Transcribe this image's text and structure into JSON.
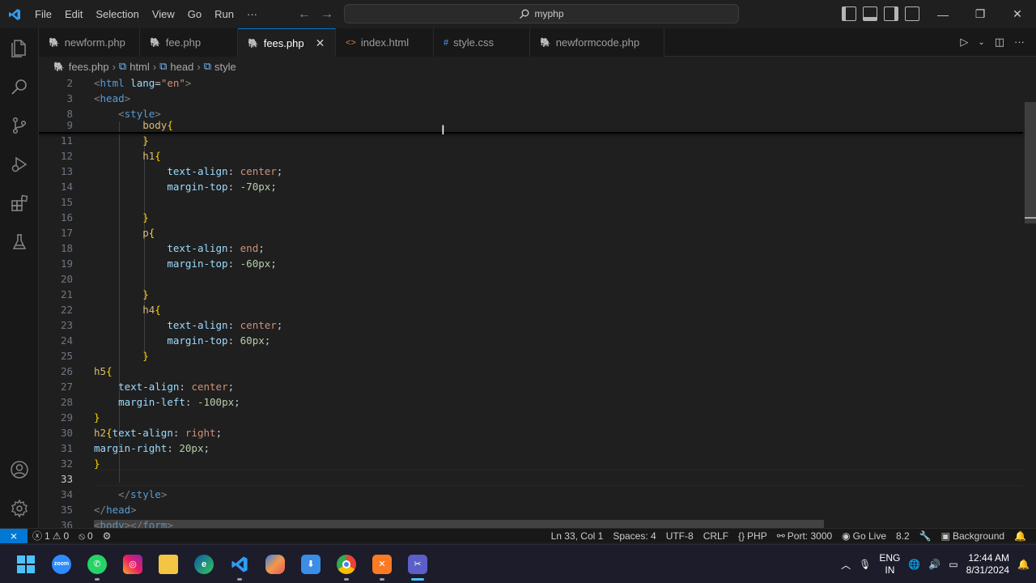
{
  "titlebar": {
    "menu": [
      "File",
      "Edit",
      "Selection",
      "View",
      "Go",
      "Run",
      "···"
    ],
    "search": "myphp"
  },
  "tabs": [
    {
      "label": "newform.php",
      "type": "php",
      "active": false
    },
    {
      "label": "fee.php",
      "type": "php",
      "active": false
    },
    {
      "label": "fees.php",
      "type": "php",
      "active": true
    },
    {
      "label": "index.html",
      "type": "html",
      "active": false
    },
    {
      "label": "style.css",
      "type": "css",
      "active": false
    },
    {
      "label": "newformcode.php",
      "type": "php",
      "active": false
    }
  ],
  "breadcrumb": [
    "fees.php",
    "html",
    "head",
    "style"
  ],
  "editor": {
    "current_line": "33",
    "lines": [
      {
        "n": "2",
        "text": "<html lang=\"en\">"
      },
      {
        "n": "3",
        "text": "<head>"
      },
      {
        "n": "8",
        "text": "    <style>"
      },
      {
        "n": "9",
        "text": "        body{"
      },
      {
        "n": "11",
        "text": "        }"
      },
      {
        "n": "12",
        "text": "        h1{"
      },
      {
        "n": "13",
        "text": "            text-align: center;"
      },
      {
        "n": "14",
        "text": "            margin-top: -70px;"
      },
      {
        "n": "15",
        "text": ""
      },
      {
        "n": "16",
        "text": "        }"
      },
      {
        "n": "17",
        "text": "        p{"
      },
      {
        "n": "18",
        "text": "            text-align: end;"
      },
      {
        "n": "19",
        "text": "            margin-top: -60px;"
      },
      {
        "n": "20",
        "text": ""
      },
      {
        "n": "21",
        "text": "        }"
      },
      {
        "n": "22",
        "text": "        h4{"
      },
      {
        "n": "23",
        "text": "            text-align: center;"
      },
      {
        "n": "24",
        "text": "            margin-top: 60px;"
      },
      {
        "n": "25",
        "text": "        }"
      },
      {
        "n": "26",
        "text": "h5{"
      },
      {
        "n": "27",
        "text": "    text-align: center;"
      },
      {
        "n": "28",
        "text": "    margin-left: -100px;"
      },
      {
        "n": "29",
        "text": "}"
      },
      {
        "n": "30",
        "text": "h2{text-align: right;"
      },
      {
        "n": "31",
        "text": "margin-right: 20px;"
      },
      {
        "n": "32",
        "text": "}"
      },
      {
        "n": "33",
        "text": ""
      },
      {
        "n": "34",
        "text": "    </style>"
      },
      {
        "n": "35",
        "text": "</head>"
      },
      {
        "n": "36",
        "text": "<body></form>"
      }
    ]
  },
  "statusbar": {
    "errors": "1",
    "warnings": "0",
    "ports": "0",
    "position": "Ln 33, Col 1",
    "spaces": "Spaces: 4",
    "encoding": "UTF-8",
    "eol": "CRLF",
    "language": "PHP",
    "port": "Port: 3000",
    "golive": "Go Live",
    "version": "8.2",
    "background": "Background"
  },
  "taskbar": {
    "apps": [
      {
        "name": "start",
        "label": ""
      },
      {
        "name": "zoom",
        "label": "zoom"
      },
      {
        "name": "whatsapp",
        "label": ""
      },
      {
        "name": "instagram",
        "label": ""
      },
      {
        "name": "file-explorer",
        "label": ""
      },
      {
        "name": "edge",
        "label": ""
      },
      {
        "name": "vscode",
        "label": ""
      },
      {
        "name": "copilot",
        "label": ""
      },
      {
        "name": "app-installer",
        "label": ""
      },
      {
        "name": "chrome",
        "label": ""
      },
      {
        "name": "xampp",
        "label": ""
      },
      {
        "name": "snipping-tool",
        "label": ""
      }
    ],
    "lang_top": "ENG",
    "lang_bottom": "IN",
    "time": "12:44 AM",
    "date": "8/31/2024"
  }
}
